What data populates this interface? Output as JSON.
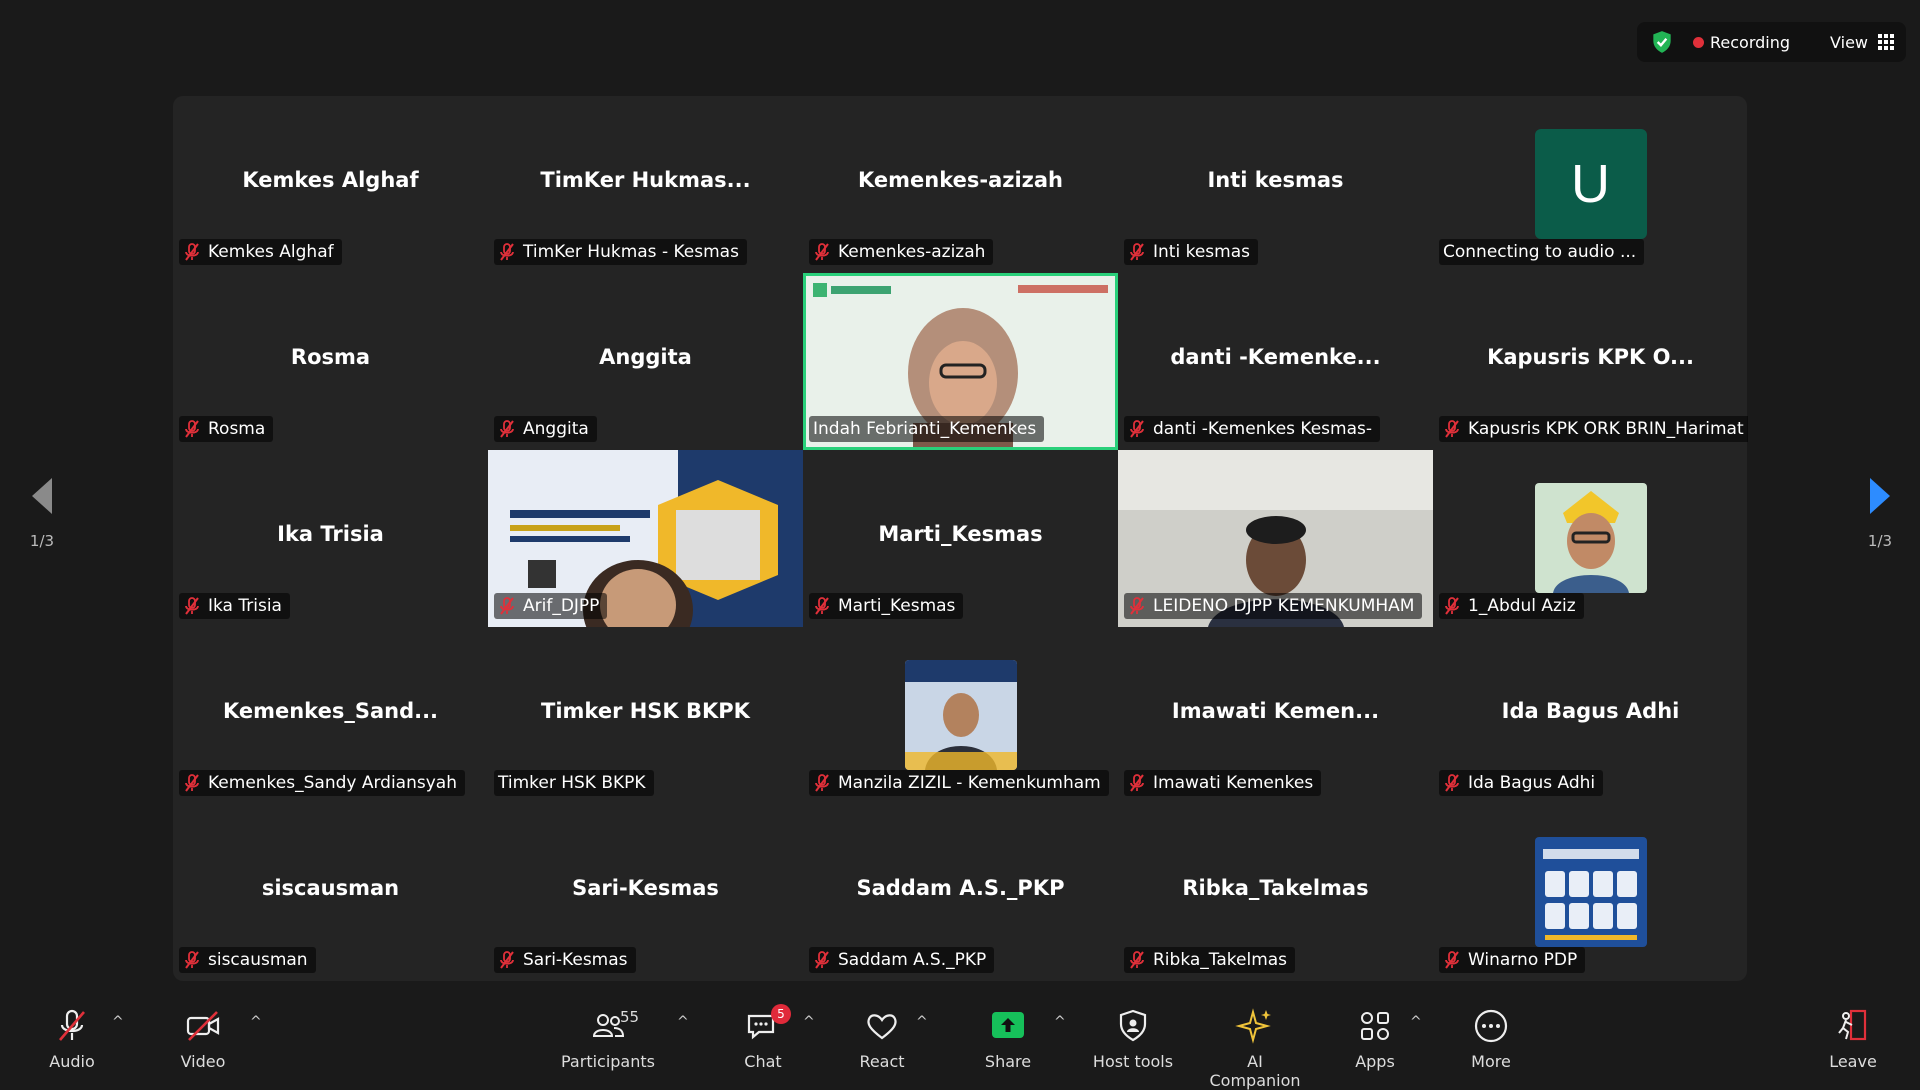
{
  "top_bar": {
    "recording_label": "Recording",
    "view_label": "View"
  },
  "tiles": [
    {
      "title": "Kemkes Alghaf",
      "name": "Kemkes Alghaf",
      "muted": true
    },
    {
      "title": "TimKer  Hukmas...",
      "name": "TimKer Hukmas - Kesmas",
      "muted": true
    },
    {
      "title": "Kemenkes-azizah",
      "name": "Kemenkes-azizah",
      "muted": true
    },
    {
      "title": "Inti kesmas",
      "name": "Inti kesmas",
      "muted": true
    },
    {
      "title": "",
      "name": "Connecting to audio ...",
      "muted": false,
      "avatar_letter": "U"
    },
    {
      "title": "Rosma",
      "name": "Rosma",
      "muted": true
    },
    {
      "title": "Anggita",
      "name": "Anggita",
      "muted": true
    },
    {
      "title": "",
      "name": "Indah Febrianti_Kemenkes",
      "muted": false,
      "video": true,
      "active": true
    },
    {
      "title": "danti  -Kemenke...",
      "name": "danti -Kemenkes Kesmas-",
      "muted": true
    },
    {
      "title": "Kapusris KPK O...",
      "name": "Kapusris KPK ORK BRIN_Harimat",
      "muted": true
    },
    {
      "title": "Ika Trisia",
      "name": "Ika Trisia",
      "muted": true
    },
    {
      "title": "",
      "name": "Arif_DJPP",
      "muted": true,
      "video": true
    },
    {
      "title": "Marti_Kesmas",
      "name": "Marti_Kesmas",
      "muted": true
    },
    {
      "title": "",
      "name": "LEIDENO DJPP KEMENKUMHAM",
      "muted": true,
      "video": true
    },
    {
      "title": "",
      "name": "1_Abdul Aziz",
      "muted": true,
      "photo": true
    },
    {
      "title": "Kemenkes_Sand...",
      "name": "Kemenkes_Sandy Ardiansyah",
      "muted": true
    },
    {
      "title": "Timker HSK BKPK",
      "name": "Timker HSK BKPK",
      "muted": false
    },
    {
      "title": "",
      "name": "Manzila ZIZIL - Kemenkumham",
      "muted": true,
      "photo": true
    },
    {
      "title": "Imawati  Kemen...",
      "name": "Imawati Kemenkes",
      "muted": true
    },
    {
      "title": "Ida Bagus Adhi",
      "name": "Ida Bagus Adhi",
      "muted": true
    },
    {
      "title": "siscausman",
      "name": "siscausman",
      "muted": true
    },
    {
      "title": "Sari-Kesmas",
      "name": "Sari-Kesmas",
      "muted": true
    },
    {
      "title": "Saddam A.S._PKP",
      "name": "Saddam A.S._PKP",
      "muted": true
    },
    {
      "title": "Ribka_Takelmas",
      "name": "Ribka_Takelmas",
      "muted": true
    },
    {
      "title": "",
      "name": "Winarno PDP",
      "muted": true,
      "photo": true
    }
  ],
  "pagination": {
    "left": "1/3",
    "right": "1/3"
  },
  "toolbar": {
    "audio": "Audio",
    "video": "Video",
    "participants": "Participants",
    "participants_count": "55",
    "chat": "Chat",
    "chat_badge": "5",
    "react": "React",
    "share": "Share",
    "host_tools": "Host tools",
    "ai_companion": "AI Companion",
    "apps": "Apps",
    "more": "More",
    "leave": "Leave"
  },
  "colors": {
    "accent_green": "#29d07a",
    "share_green": "#16c05a",
    "muted_red": "#e0303a",
    "avatar_bg": "#0b5c49"
  }
}
